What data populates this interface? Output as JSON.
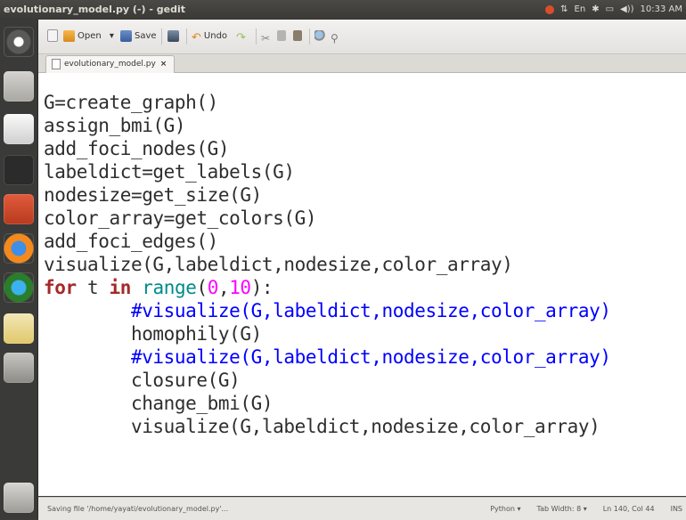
{
  "window": {
    "title": "evolutionary_model.py (-) - gedit"
  },
  "tray": {
    "network": "⇅",
    "keyboard": "En",
    "bluetooth": "✱",
    "battery": "▭",
    "volume": "◀))",
    "clock": "10:33 AM"
  },
  "toolbar": {
    "open_label": "Open",
    "save_label": "Save",
    "undo_label": "Undo",
    "open_dropdown": "▾"
  },
  "tab": {
    "label": "evolutionary_model.py",
    "close": "×"
  },
  "editor": {
    "lines": [
      {
        "tokens": [
          {
            "t": "G=create_graph()",
            "c": ""
          }
        ]
      },
      {
        "tokens": [
          {
            "t": "assign_bmi(G)",
            "c": ""
          }
        ]
      },
      {
        "tokens": [
          {
            "t": "add_foci_nodes(G)",
            "c": ""
          }
        ]
      },
      {
        "tokens": [
          {
            "t": "labeldict=get_labels(G)",
            "c": ""
          }
        ]
      },
      {
        "tokens": [
          {
            "t": "nodesize=get_size(G)",
            "c": ""
          }
        ]
      },
      {
        "tokens": [
          {
            "t": "color_array=get_colors(G)",
            "c": ""
          }
        ]
      },
      {
        "tokens": [
          {
            "t": "add_foci_edges()",
            "c": ""
          }
        ]
      },
      {
        "tokens": [
          {
            "t": "visualize(G,labeldict,nodesize,color_array)",
            "c": ""
          }
        ]
      },
      {
        "tokens": [
          {
            "t": "for",
            "c": "kw"
          },
          {
            "t": " t ",
            "c": ""
          },
          {
            "t": "in",
            "c": "kw"
          },
          {
            "t": " ",
            "c": ""
          },
          {
            "t": "range",
            "c": "fn"
          },
          {
            "t": "(",
            "c": ""
          },
          {
            "t": "0",
            "c": "num"
          },
          {
            "t": ",",
            "c": ""
          },
          {
            "t": "10",
            "c": "num"
          },
          {
            "t": "):",
            "c": ""
          }
        ]
      },
      {
        "tokens": [
          {
            "t": "        #visualize(G,labeldict,nodesize,color_array)",
            "c": "cm"
          }
        ]
      },
      {
        "tokens": [
          {
            "t": "        homophily(G)",
            "c": ""
          }
        ]
      },
      {
        "tokens": [
          {
            "t": "        #visualize(G,labeldict,nodesize,color_array)",
            "c": "cm"
          }
        ]
      },
      {
        "tokens": [
          {
            "t": "        closure(G)",
            "c": ""
          }
        ]
      },
      {
        "tokens": [
          {
            "t": "        change_bmi(G)",
            "c": ""
          }
        ]
      },
      {
        "tokens": [
          {
            "t": "        visualize(G,labeldict,nodesize,color_array)",
            "c": ""
          }
        ]
      }
    ]
  },
  "statusbar": {
    "message": "Saving file '/home/yayati/evolutionary_model.py'...",
    "language": "Python ▾",
    "tab_width": "Tab Width: 8 ▾",
    "position": "Ln 140, Col 44",
    "mode": "INS"
  },
  "colors": {
    "keyword": "#a52a2a",
    "builtin": "#008b8b",
    "number": "#ff00ff",
    "comment": "#0000ff",
    "panel": "#3c3b37"
  },
  "launcher": {
    "icons": [
      "ubuntu-dash-icon",
      "files-icon",
      "text-editor-icon",
      "terminal-icon",
      "settings-icon",
      "firefox-icon",
      "browser-icon",
      "system-monitor-icon",
      "usb-drive-icon",
      "trash-icon"
    ]
  }
}
